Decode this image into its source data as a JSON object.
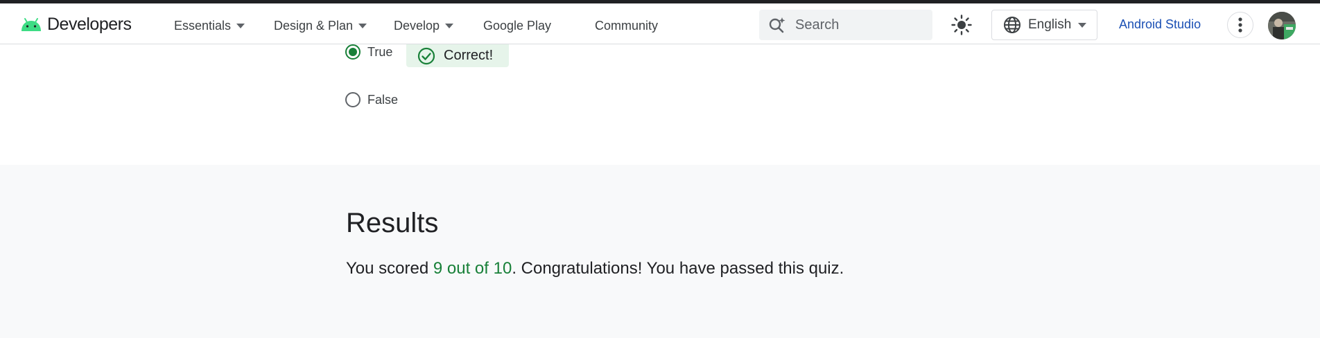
{
  "header": {
    "brand": "Developers",
    "nav": [
      {
        "label": "Essentials",
        "dropdown": true
      },
      {
        "label": "Design & Plan",
        "dropdown": true
      },
      {
        "label": "Develop",
        "dropdown": true
      },
      {
        "label": "Google Play",
        "dropdown": false
      },
      {
        "label": "Community",
        "dropdown": false
      }
    ],
    "search": {
      "placeholder": "Search",
      "icon": "search-spark-icon"
    },
    "theme_icon": "sun-icon",
    "language": {
      "label": "English",
      "icon": "globe-icon"
    },
    "studio_link": "Android Studio",
    "more_icon": "more-vert-icon"
  },
  "question": {
    "options": [
      {
        "label": "True",
        "selected": true
      },
      {
        "label": "False",
        "selected": false
      }
    ],
    "feedback": "Correct!"
  },
  "results": {
    "title": "Results",
    "prefix": "You scored ",
    "score": "9 out of 10",
    "suffix": ". Congratulations! You have passed this quiz."
  },
  "colors": {
    "accent_green": "#188038",
    "link_blue": "#1a4fb4",
    "results_bg": "#f8f9fa",
    "feedback_bg": "#e6f4ea",
    "android_green": "#3ddc84"
  }
}
